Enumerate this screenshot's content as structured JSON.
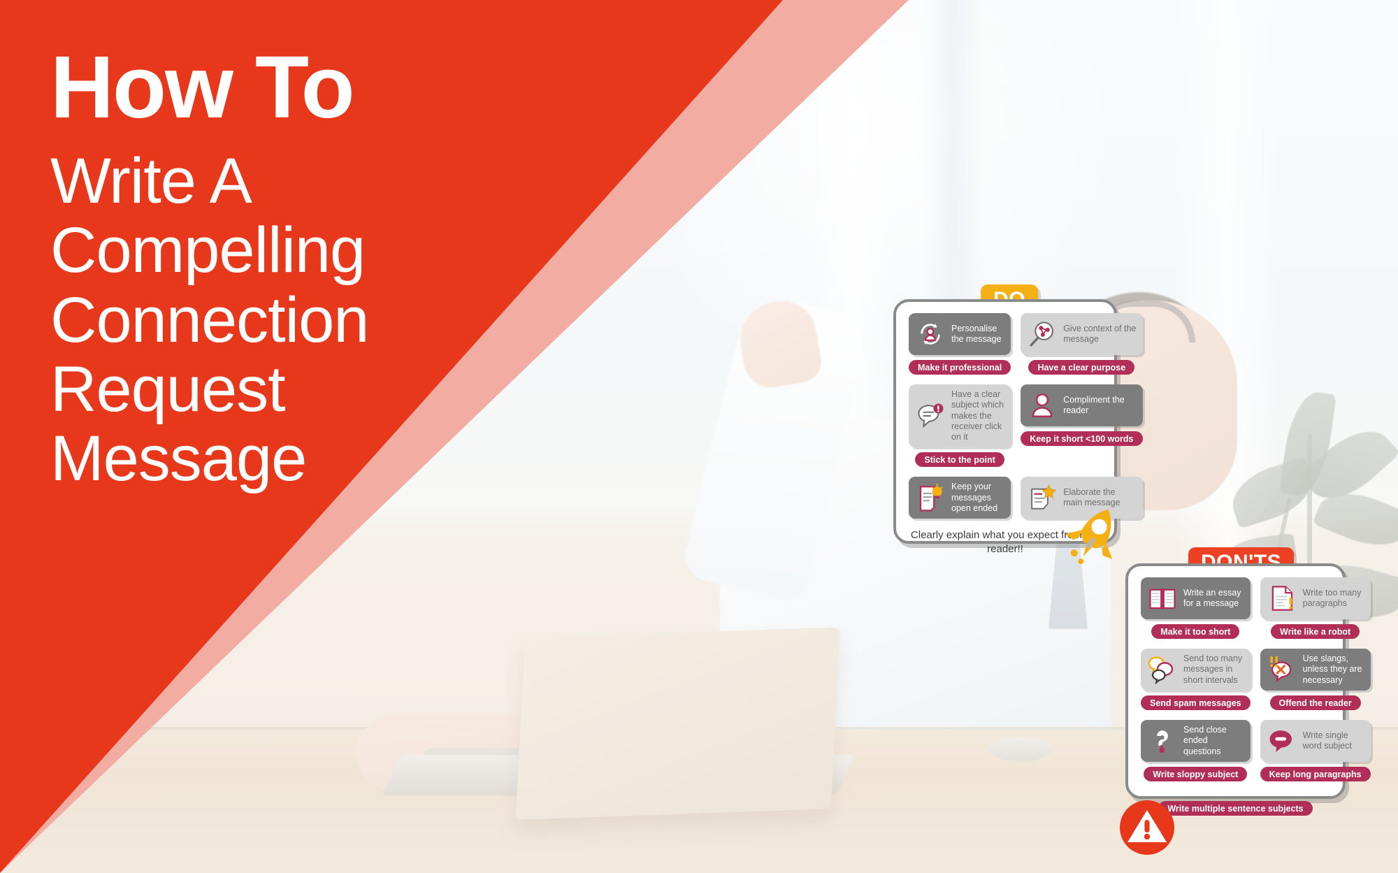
{
  "title": {
    "main": "How To",
    "sub_lines": [
      "Write A",
      "Compelling",
      "Connection",
      "Request",
      "Message"
    ]
  },
  "colors": {
    "brand_red": "#E8381C",
    "band_pink": "#F3ACA2",
    "pill_crimson": "#B02E58",
    "tag_do_yellow": "#F5B014",
    "tag_dont_red": "#EE4023",
    "tile_dark": "#7D7D7D",
    "tile_light": "#D4D4D4",
    "card_border": "#8A8A8A"
  },
  "do_card": {
    "tag": "DO",
    "items": [
      {
        "tile": "Personalise the message",
        "icon": "refresh-person-icon",
        "style": "dark",
        "pill": "Make it professional"
      },
      {
        "tile": "Give context of the message",
        "icon": "magnifier-network-icon",
        "style": "light",
        "pill": "Have a clear purpose"
      },
      {
        "tile": "Have a clear subject which makes the receiver click on it",
        "icon": "speech-bubble-alert-icon",
        "style": "light",
        "pill": "Stick to the point"
      },
      {
        "tile": "Compliment the reader",
        "icon": "person-icon",
        "style": "dark",
        "pill": "Keep it short <100 words"
      },
      {
        "tile": "Keep your messages open ended",
        "icon": "document-lightbulb-icon",
        "style": "dark",
        "pill": ""
      },
      {
        "tile": "Elaborate the main message",
        "icon": "document-star-icon",
        "style": "light",
        "pill": ""
      }
    ],
    "footer": "Clearly explain what you expect from the reader!!",
    "decoration_icon": "rocket-icon"
  },
  "donts_card": {
    "tag": "DON'TS",
    "items": [
      {
        "tile": "Write an essay for a message",
        "icon": "open-book-icon",
        "style": "dark",
        "pill": "Make it too short"
      },
      {
        "tile": "Write too many paragraphs",
        "icon": "document-exclamation-icon",
        "style": "light",
        "pill": "Write like a robot"
      },
      {
        "tile": "Send too many messages in short intervals",
        "icon": "multiple-chat-bubbles-icon",
        "style": "light",
        "pill": "Send spam messages"
      },
      {
        "tile": "Use slangs, unless they are necessary",
        "icon": "chat-bubble-cross-icon",
        "style": "dark",
        "pill": "Offend the reader"
      },
      {
        "tile": "Send close ended questions",
        "icon": "question-mark-icon",
        "style": "dark",
        "pill": "Write sloppy subject"
      },
      {
        "tile": "Write single word subject",
        "icon": "chat-bubble-minus-icon",
        "style": "light",
        "pill": "Keep long paragraphs"
      }
    ],
    "footer_pill": "Write multiple sentence subjects",
    "decoration_icon": "warning-triangle-icon"
  }
}
